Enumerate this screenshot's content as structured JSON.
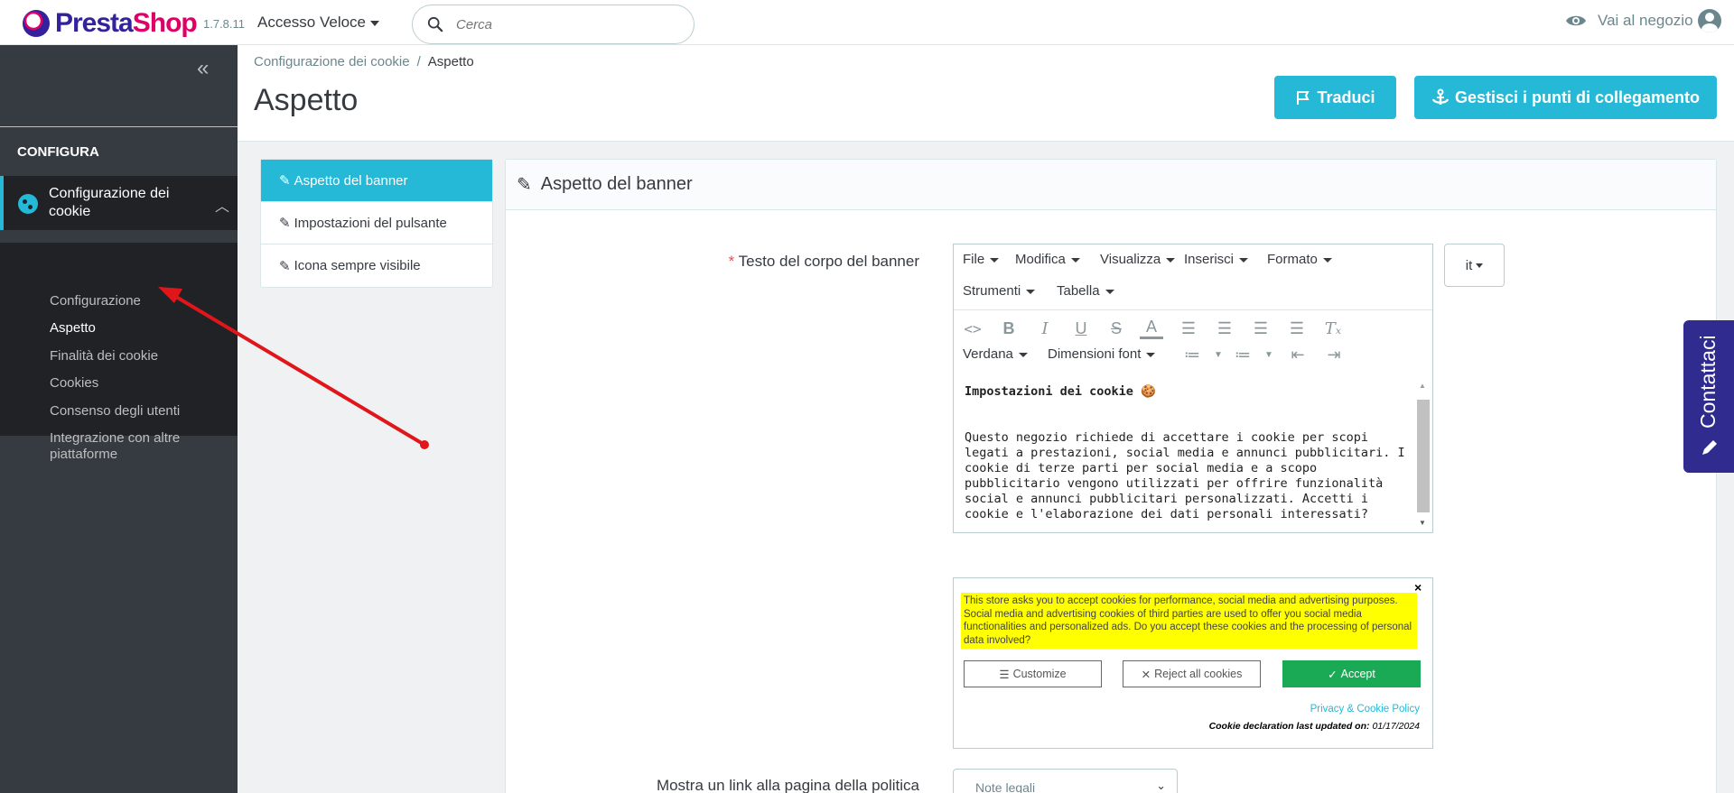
{
  "header": {
    "logo_prefix": "Presta",
    "logo_suffix": "Shop",
    "version": "1.7.8.11",
    "quick_access": "Accesso Veloce",
    "search_placeholder": "Cerca",
    "shop_link": "Vai al negozio"
  },
  "sidebar": {
    "heading": "CONFIGURA",
    "active_item": "Configurazione dei cookie",
    "submenu": [
      "Configurazione",
      "Aspetto",
      "Finalità dei cookie",
      "Cookies",
      "Consenso degli utenti",
      "Integrazione con altre piattaforme"
    ]
  },
  "breadcrumb": {
    "parent": "Configurazione dei cookie",
    "separator": "/",
    "current": "Aspetto"
  },
  "page_title": "Aspetto",
  "toolbar": {
    "translate_label": "Traduci",
    "hooks_label": "Gestisci i punti di collegamento"
  },
  "tabs": [
    "Aspetto del banner",
    "Impostazioni del pulsante",
    "Icona sempre visibile"
  ],
  "panel": {
    "title": "Aspetto del banner",
    "body_text_label": "Testo del corpo del banner",
    "required_mark": "*",
    "policy_link_label": "Mostra un link alla pagina della politica"
  },
  "editor": {
    "menu": [
      "File",
      "Modifica",
      "Visualizza",
      "Inserisci",
      "Formato",
      "Strumenti",
      "Tabella"
    ],
    "font_family": "Verdana",
    "font_size": "Dimensioni font",
    "content_title": "Impostazioni dei cookie",
    "content_title_emoji": "🍪",
    "content_body": "Questo negozio richiede di accettare i cookie per scopi legati a prestazioni, social media e annunci pubblicitari. I cookie di terze parti per social media e a scopo pubblicitario vengono utilizzati per offrire funzionalità social e annunci pubblicitari personalizzati. Accetti i cookie e l'elaborazione dei dati personali interessati?"
  },
  "language": {
    "selected": "it"
  },
  "preview": {
    "close": "×",
    "text": "This store asks you to accept cookies for performance, social media and advertising purposes. Social media and advertising cookies of third parties are used to offer you social media functionalities and personalized ads. Do you accept these cookies and the processing of personal data involved?",
    "customize": "Customize",
    "reject": "Reject all cookies",
    "accept": "Accept",
    "policy_link": "Privacy & Cookie Policy",
    "declaration_label": "Cookie declaration last updated on:",
    "declaration_date": "01/17/2024"
  },
  "policy_select": {
    "selected": "Note legali"
  },
  "contact_tab": {
    "label": "Contattaci"
  },
  "colors": {
    "accent": "#25b9d7",
    "sidebar_bg": "#363a41",
    "sidebar_active_bg": "#202226",
    "required": "#e84f4f",
    "preview_highlight": "#ffff00",
    "accept_green": "#1aaa55",
    "contact_tab": "#2f2b8f",
    "annotation_arrow": "#e0161b"
  },
  "icons": {
    "search": "search-icon",
    "shop": "eye-icon",
    "user": "user-icon",
    "collapse": "double-chevron-left-icon",
    "cookie": "cookie-icon",
    "translate": "flag-icon",
    "hooks": "anchor-icon",
    "edit": "pencil-icon"
  }
}
